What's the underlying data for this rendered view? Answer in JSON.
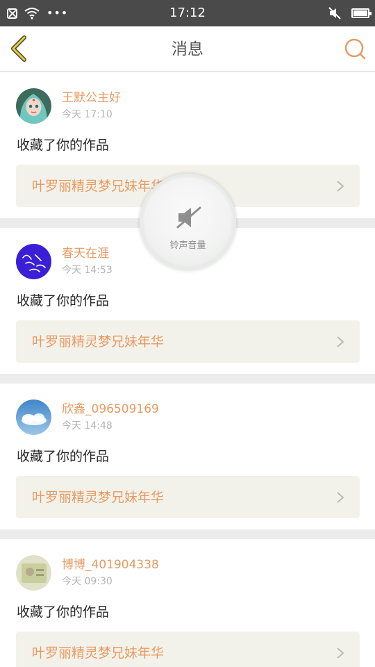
{
  "status_bar": {
    "time": "17:12",
    "left_icons": [
      "close-notification-icon",
      "wifi-icon",
      "more-dots-icon"
    ],
    "right_icons": [
      "mute-icon",
      "battery-icon"
    ]
  },
  "nav": {
    "title": "消息",
    "back_icon": "chevron-left-icon",
    "search_icon": "search-icon",
    "accent_color": "#e89a62"
  },
  "messages": [
    {
      "username": "王默公主好",
      "time": "今天 17:10",
      "action": "收藏了你的作品",
      "work_title": "叶罗丽精灵梦兄妹年华"
    },
    {
      "username": "春天在涯",
      "time": "今天 14:53",
      "action": "收藏了你的作品",
      "work_title": "叶罗丽精灵梦兄妹年华"
    },
    {
      "username": "欣鑫_096509169",
      "time": "今天 14:48",
      "action": "收藏了你的作品",
      "work_title": "叶罗丽精灵梦兄妹年华"
    },
    {
      "username": "博博_401904338",
      "time": "今天 09:30",
      "action": "收藏了你的作品",
      "work_title": "叶罗丽精灵梦兄妹年华"
    }
  ],
  "volume_toast": {
    "label": "铃声音量",
    "icon": "speaker-muted-icon"
  }
}
